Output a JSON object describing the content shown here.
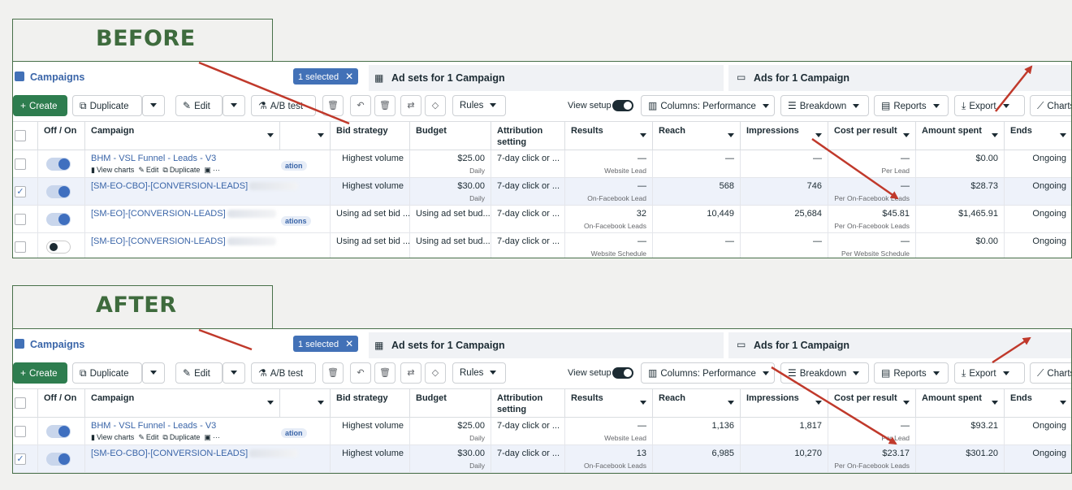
{
  "before": {
    "label": "BEFORE",
    "campaigns_title": "Campaigns",
    "selected_pill": "1 selected",
    "tab_adsets": "Ad sets for 1 Campaign",
    "tab_ads": "Ads for 1 Campaign",
    "toolbar": {
      "create": "Create",
      "duplicate": "Duplicate",
      "edit": "Edit",
      "ab_test": "A/B test",
      "rules": "Rules",
      "view_setup": "View setup",
      "columns": "Columns: Performance",
      "breakdown": "Breakdown",
      "reports": "Reports",
      "export": "Export",
      "charts": "Charts"
    },
    "headers": {
      "off_on": "Off / On",
      "campaign": "Campaign",
      "bid_strategy": "Bid strategy",
      "budget": "Budget",
      "attribution": "Attribution setting",
      "results": "Results",
      "reach": "Reach",
      "impressions": "Impressions",
      "cost_per_result": "Cost per result",
      "amount_spent": "Amount spent",
      "ends": "Ends"
    },
    "rows": [
      {
        "name": "BHM - VSL Funnel - Leads - V3",
        "tag": "ation",
        "bid": "Highest volume",
        "budget": "$25.00",
        "budget_sub": "Daily",
        "attr": "7-day click or ...",
        "results": "—",
        "results_sub": "Website Lead",
        "reach": "—",
        "impressions": "—",
        "cpr": "—",
        "cpr_sub": "Per Lead",
        "spent": "$0.00",
        "ends": "Ongoing"
      },
      {
        "name": "[SM-EO-CBO]-[CONVERSION-LEADS]",
        "tag": "",
        "bid": "Highest volume",
        "budget": "$30.00",
        "budget_sub": "Daily",
        "attr": "7-day click or ...",
        "results": "—",
        "results_sub": "On-Facebook Lead",
        "reach": "568",
        "impressions": "746",
        "cpr": "—",
        "cpr_sub": "Per On-Facebook Leads",
        "spent": "$28.73",
        "ends": "Ongoing"
      },
      {
        "name": "[SM-EO]-[CONVERSION-LEADS]",
        "tag": "ations",
        "bid": "Using ad set bid ...",
        "budget": "Using ad set bud...",
        "budget_sub": "",
        "attr": "7-day click or ...",
        "results": "32",
        "results_sub": "On-Facebook Leads",
        "reach": "10,449",
        "impressions": "25,684",
        "cpr": "$45.81",
        "cpr_sub": "Per On-Facebook Leads",
        "spent": "$1,465.91",
        "ends": "Ongoing"
      },
      {
        "name": "[SM-EO]-[CONVERSION-LEADS]",
        "tag": "",
        "bid": "Using ad set bid ...",
        "budget": "Using ad set bud...",
        "budget_sub": "",
        "attr": "7-day click or ...",
        "results": "—",
        "results_sub": "Website Schedule",
        "reach": "—",
        "impressions": "—",
        "cpr": "—",
        "cpr_sub": "Per Website Schedule",
        "spent": "$0.00",
        "ends": "Ongoing"
      }
    ],
    "row_actions": {
      "view_charts": "View charts",
      "edit": "Edit",
      "duplicate": "Duplicate",
      "more": "···"
    }
  },
  "after": {
    "label": "AFTER",
    "rows": [
      {
        "name": "BHM - VSL Funnel - Leads - V3",
        "tag": "ation",
        "bid": "Highest volume",
        "budget": "$25.00",
        "budget_sub": "Daily",
        "attr": "7-day click or ...",
        "results": "—",
        "results_sub": "Website Lead",
        "reach": "1,136",
        "impressions": "1,817",
        "cpr": "—",
        "cpr_sub": "Per Lead",
        "spent": "$93.21",
        "ends": "Ongoing"
      },
      {
        "name": "[SM-EO-CBO]-[CONVERSION-LEADS]",
        "tag": "",
        "bid": "Highest volume",
        "budget": "$30.00",
        "budget_sub": "Daily",
        "attr": "7-day click or ...",
        "results": "13",
        "results_sub": "On-Facebook Leads",
        "reach": "6,985",
        "impressions": "10,270",
        "cpr": "$23.17",
        "cpr_sub": "Per On-Facebook Leads",
        "spent": "$301.20",
        "ends": "Ongoing"
      }
    ]
  },
  "colors": {
    "accent_green": "#3e6b3d",
    "create_button": "#2e7d4f",
    "link_blue": "#3a65a8",
    "arrow_red": "#c0392b"
  }
}
